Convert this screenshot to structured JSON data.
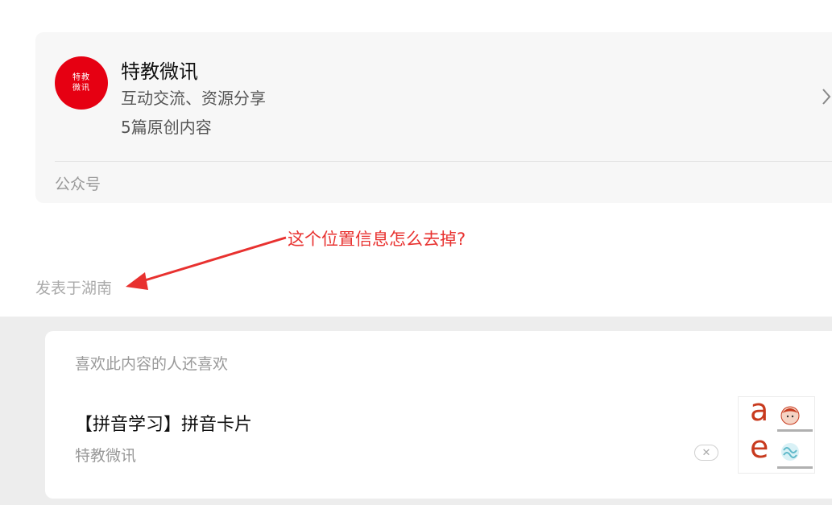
{
  "profile": {
    "avatar_line1": "特教",
    "avatar_line2": "微讯",
    "name": "特教微讯",
    "description": "互动交流、资源分享",
    "count": "5篇原创内容",
    "footer": "公众号",
    "avatar_color": "#e60012"
  },
  "annotation": {
    "text": "这个位置信息怎么去掉?",
    "color": "#e8312f"
  },
  "location": "发表于湖南",
  "recommend": {
    "header": "喜欢此内容的人还喜欢",
    "item": {
      "title": "【拼音学习】拼音卡片",
      "source": "特教微讯",
      "dismiss_icon": "close-icon",
      "dismiss_glyph": "✕",
      "thumb_letter1": "a",
      "thumb_letter2": "e"
    }
  }
}
